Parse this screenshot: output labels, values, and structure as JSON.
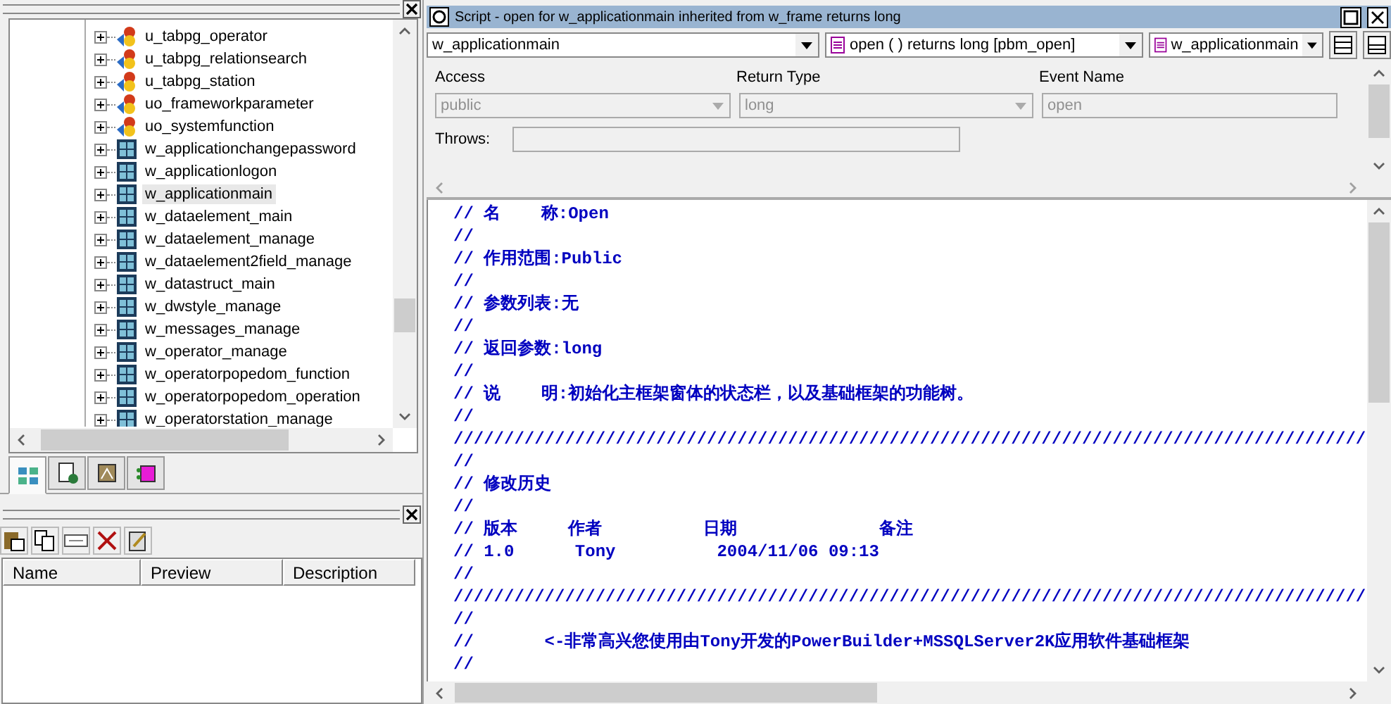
{
  "tree": {
    "items": [
      {
        "label": "u_tabpg_operator",
        "kind": "object",
        "selected": false
      },
      {
        "label": "u_tabpg_relationsearch",
        "kind": "object",
        "selected": false
      },
      {
        "label": "u_tabpg_station",
        "kind": "object",
        "selected": false
      },
      {
        "label": "uo_frameworkparameter",
        "kind": "object",
        "selected": false
      },
      {
        "label": "uo_systemfunction",
        "kind": "object",
        "selected": false
      },
      {
        "label": "w_applicationchangepassword",
        "kind": "window",
        "selected": false
      },
      {
        "label": "w_applicationlogon",
        "kind": "window",
        "selected": false
      },
      {
        "label": "w_applicationmain",
        "kind": "window",
        "selected": true
      },
      {
        "label": "w_dataelement_main",
        "kind": "window",
        "selected": false
      },
      {
        "label": "w_dataelement_manage",
        "kind": "window",
        "selected": false
      },
      {
        "label": "w_dataelement2field_manage",
        "kind": "window",
        "selected": false
      },
      {
        "label": "w_datastruct_main",
        "kind": "window",
        "selected": false
      },
      {
        "label": "w_dwstyle_manage",
        "kind": "window",
        "selected": false
      },
      {
        "label": "w_messages_manage",
        "kind": "window",
        "selected": false
      },
      {
        "label": "w_operator_manage",
        "kind": "window",
        "selected": false
      },
      {
        "label": "w_operatorpopedom_function",
        "kind": "window",
        "selected": false
      },
      {
        "label": "w_operatorpopedom_operation",
        "kind": "window",
        "selected": false
      },
      {
        "label": "w_operatorstation_manage",
        "kind": "window",
        "selected": false
      }
    ]
  },
  "view_tabs": [
    {
      "kind": "objects",
      "selected": true
    },
    {
      "kind": "document",
      "selected": false
    },
    {
      "kind": "picture",
      "selected": false
    },
    {
      "kind": "component",
      "selected": false
    }
  ],
  "clip_panel": {
    "columns": [
      "Name",
      "Preview",
      "Description"
    ]
  },
  "script": {
    "title": "Script - open for w_applicationmain inherited from w_frame returns long",
    "object_combo": "w_applicationmain",
    "event_combo": "open ( )  returns long [pbm_open]",
    "ancestor_combo": "w_applicationmain",
    "access_label": "Access",
    "access_value": "public",
    "return_label": "Return Type",
    "return_value": "long",
    "event_label": "Event Name",
    "event_value": "open",
    "throws_label": "Throws:",
    "code_lines": [
      "// 名    称:Open",
      "//",
      "// 作用范围:Public",
      "//",
      "// 参数列表:无",
      "//",
      "// 返回参数:long",
      "//",
      "// 说    明:初始化主框架窗体的状态栏，以及基础框架的功能树。",
      "//",
      "//////////////////////////////////////////////////////////////////////////////////////////",
      "//",
      "// 修改历史",
      "//",
      "// 版本     作者          日期              备注",
      "// 1.0      Tony          2004/11/06 09:13",
      "//",
      "//////////////////////////////////////////////////////////////////////////////////////////",
      "//",
      "//       <-非常高兴您使用由Tony开发的PowerBuilder+MSSQLServer2K应用软件基础框架",
      "//"
    ]
  }
}
